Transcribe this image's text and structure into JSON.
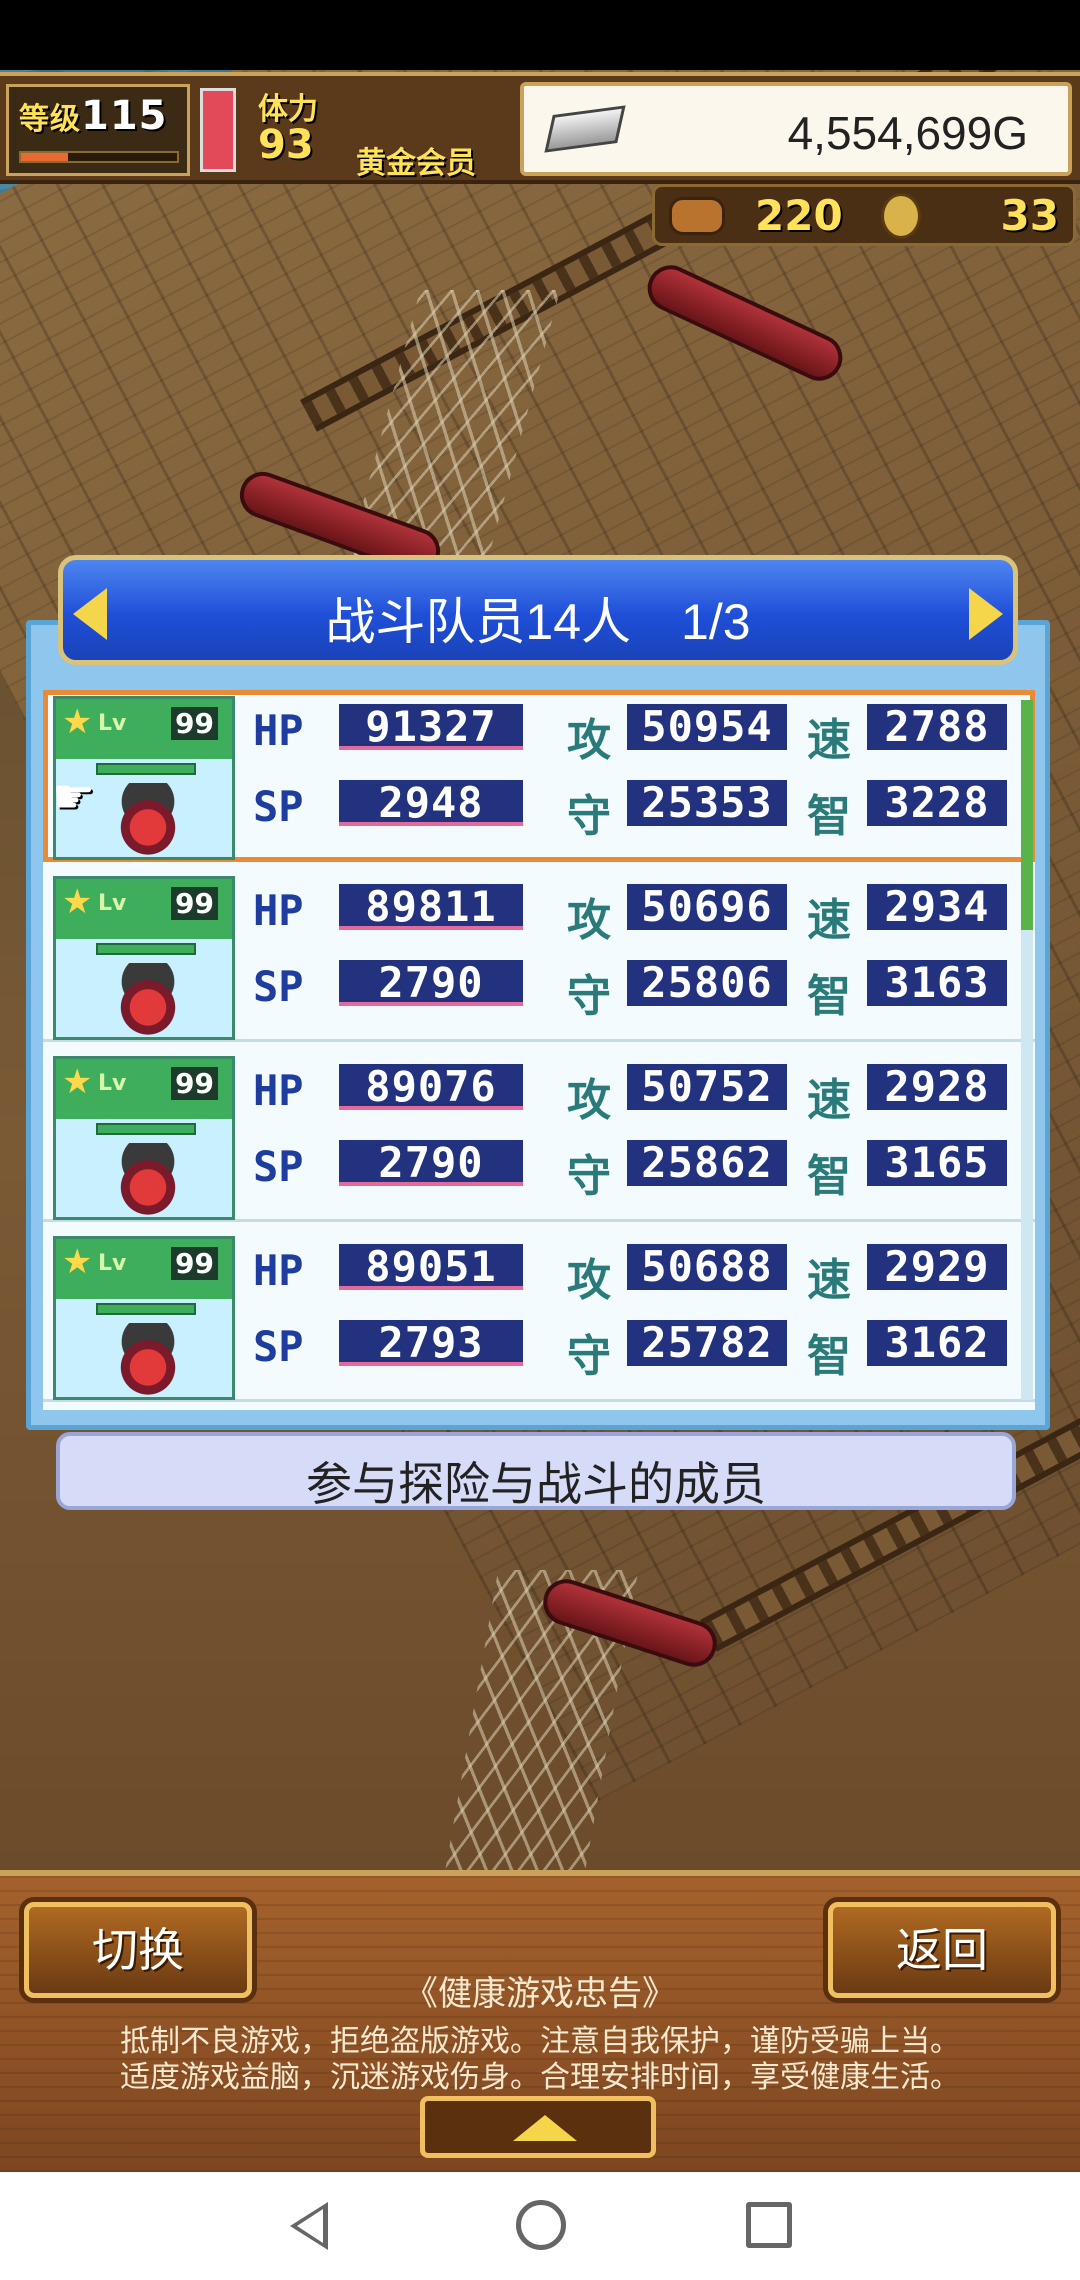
{
  "hud": {
    "level_label": "等级",
    "level_value": "115",
    "stamina_label": "体力",
    "stamina_value": "93",
    "member_label": "黄金会员",
    "gold": "4,554,699G",
    "currency_a": "220",
    "currency_b": "33"
  },
  "panel": {
    "title": "战斗队员14人　1/3",
    "caption": "参与探险与战斗的成员"
  },
  "stat_labels": {
    "hp": "HP",
    "sp": "SP",
    "atk": "攻",
    "def": "守",
    "spd": "速",
    "int": "智",
    "lv": "Lv"
  },
  "members": [
    {
      "lv": "99",
      "hp": "91327",
      "sp": "2948",
      "atk": "50954",
      "def": "25353",
      "spd": "2788",
      "int": "3228",
      "selected": true
    },
    {
      "lv": "99",
      "hp": "89811",
      "sp": "2790",
      "atk": "50696",
      "def": "25806",
      "spd": "2934",
      "int": "3163",
      "selected": false
    },
    {
      "lv": "99",
      "hp": "89076",
      "sp": "2790",
      "atk": "50752",
      "def": "25862",
      "spd": "2928",
      "int": "3165",
      "selected": false
    },
    {
      "lv": "99",
      "hp": "89051",
      "sp": "2793",
      "atk": "50688",
      "def": "25782",
      "spd": "2929",
      "int": "3162",
      "selected": false
    }
  ],
  "buttons": {
    "switch": "切换",
    "back": "返回"
  },
  "notice": {
    "title": "《健康游戏忠告》",
    "line1": "抵制不良游戏，拒绝盗版游戏。注意自我保护，谨防受骗上当。",
    "line2": "适度游戏益脑，沉迷游戏伤身。合理安排时间，享受健康生活。"
  },
  "colors": {
    "panel_header": "#1f4fd8",
    "stat_value_bg": "#22327e",
    "selected_outline": "#e88a36"
  }
}
